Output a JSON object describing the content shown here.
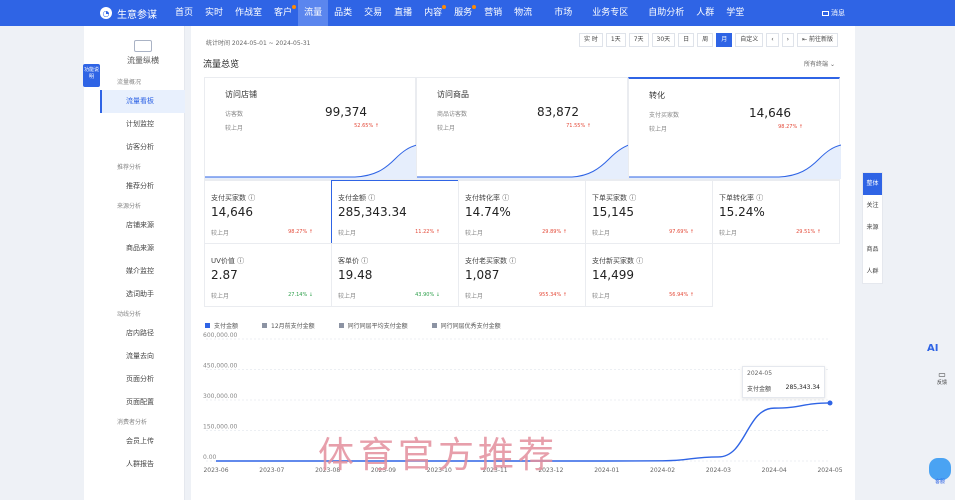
{
  "topnav": {
    "brand": "生意参谋",
    "items": [
      {
        "label": "首页",
        "badge": false
      },
      {
        "label": "实时",
        "badge": false
      },
      {
        "label": "作战室",
        "badge": false
      },
      {
        "label": "客户",
        "badge": true
      },
      {
        "label": "流量",
        "badge": false,
        "active": true
      },
      {
        "label": "品类",
        "badge": false
      },
      {
        "label": "交易",
        "badge": false
      },
      {
        "label": "直播",
        "badge": false
      },
      {
        "label": "内容",
        "badge": true
      },
      {
        "label": "服务",
        "badge": true
      },
      {
        "label": "营销",
        "badge": false
      },
      {
        "label": "物流",
        "badge": false
      },
      {
        "label": "市场",
        "badge": false
      },
      {
        "label": "业务专区",
        "badge": false
      },
      {
        "label": "自助分析",
        "badge": false
      },
      {
        "label": "人群",
        "badge": false
      },
      {
        "label": "学堂",
        "badge": false
      }
    ],
    "messages": "消息"
  },
  "sidebar": {
    "flag": "功能说明",
    "title": "流量纵横",
    "groups": [
      {
        "label": "流量概况",
        "items": [
          "流量看板",
          "计划监控",
          "访客分析"
        ]
      },
      {
        "label": "推荐分析",
        "items": [
          "推荐分析"
        ]
      },
      {
        "label": "来源分析",
        "items": [
          "店铺来源",
          "商品来源",
          "媒介监控",
          "选词助手"
        ]
      },
      {
        "label": "动线分析",
        "items": [
          "店内路径",
          "流量去向",
          "页面分析",
          "页面配置"
        ]
      },
      {
        "label": "消费者分析",
        "items": [
          "会员上传",
          "人群报告"
        ]
      }
    ],
    "active": "流量看板"
  },
  "toolbar": {
    "period": "统计时间 2024-05-01 ~ 2024-05-31",
    "buttons": [
      "实 时",
      "1天",
      "7天",
      "30天",
      "日",
      "周",
      "月",
      "自定义"
    ],
    "active": "月",
    "prev": "‹",
    "next": "›",
    "old_version": "前往新版"
  },
  "overview": {
    "title": "流量总览",
    "channel_select": "所有终端"
  },
  "big_cards": [
    {
      "title": "访问店铺",
      "label": "访客数",
      "value": "99,374",
      "compare_label": "较上月",
      "pct": "52.65%"
    },
    {
      "title": "访问商品",
      "label": "商品访客数",
      "value": "83,872",
      "compare_label": "较上月",
      "pct": "71.55%"
    },
    {
      "title": "转化",
      "label": "支付买家数",
      "value": "14,646",
      "compare_label": "较上月",
      "pct": "98.27%"
    }
  ],
  "kpis": [
    {
      "title": "支付买家数",
      "value": "14,646",
      "compare": "较上月",
      "pct": "98.27%",
      "dir": "up"
    },
    {
      "title": "支付金额",
      "value": "285,343.34",
      "compare": "较上月",
      "pct": "11.22%",
      "dir": "up"
    },
    {
      "title": "支付转化率",
      "value": "14.74%",
      "compare": "较上月",
      "pct": "29.89%",
      "dir": "up"
    },
    {
      "title": "下单买家数",
      "value": "15,145",
      "compare": "较上月",
      "pct": "97.69%",
      "dir": "up"
    },
    {
      "title": "下单转化率",
      "value": "15.24%",
      "compare": "较上月",
      "pct": "29.51%",
      "dir": "up"
    },
    {
      "title": "UV价值",
      "value": "2.87",
      "compare": "较上月",
      "pct": "27.14%",
      "dir": "down"
    },
    {
      "title": "客单价",
      "value": "19.48",
      "compare": "较上月",
      "pct": "43.90%",
      "dir": "down"
    },
    {
      "title": "支付老买家数",
      "value": "1,087",
      "compare": "较上月",
      "pct": "955.34%",
      "dir": "up"
    },
    {
      "title": "支付新买家数",
      "value": "14,499",
      "compare": "较上月",
      "pct": "56.94%",
      "dir": "up"
    }
  ],
  "legend": [
    {
      "label": "支付金额",
      "color": "#2f64e5"
    },
    {
      "label": "12月前支付金额",
      "color": "#8c93a3"
    },
    {
      "label": "同行同层平均支付金额",
      "color": "#8c93a3"
    },
    {
      "label": "同行同层优秀支付金额",
      "color": "#8c93a3"
    }
  ],
  "chart_data": {
    "type": "line",
    "x": [
      "2023-06",
      "2023-07",
      "2023-08",
      "2023-09",
      "2023-10",
      "2023-11",
      "2023-12",
      "2024-01",
      "2024-02",
      "2024-03",
      "2024-04",
      "2024-05"
    ],
    "series": [
      {
        "name": "支付金额",
        "values": [
          0,
          0,
          0,
          0,
          0,
          0,
          0,
          0,
          1000,
          20000,
          260000,
          285343.34
        ]
      }
    ],
    "yticks": [
      "600,000.00",
      "450,000.00",
      "300,000.00",
      "150,000.00",
      "0.00"
    ],
    "ylim": [
      0,
      600000
    ],
    "tooltip": {
      "date": "2024-05",
      "label": "支付金额",
      "value": "285,343.34"
    }
  },
  "right_tabs": [
    "整体",
    "关注",
    "来源",
    "商品",
    "人群"
  ],
  "right_tab_active": "整体",
  "ai_label": "AI",
  "feedback": "反馈",
  "helper": "客服",
  "watermark_text": "体育官方推荐",
  "colors": {
    "primary": "#2f64e5",
    "up": "#e44b3a",
    "down": "#2fa04c"
  }
}
